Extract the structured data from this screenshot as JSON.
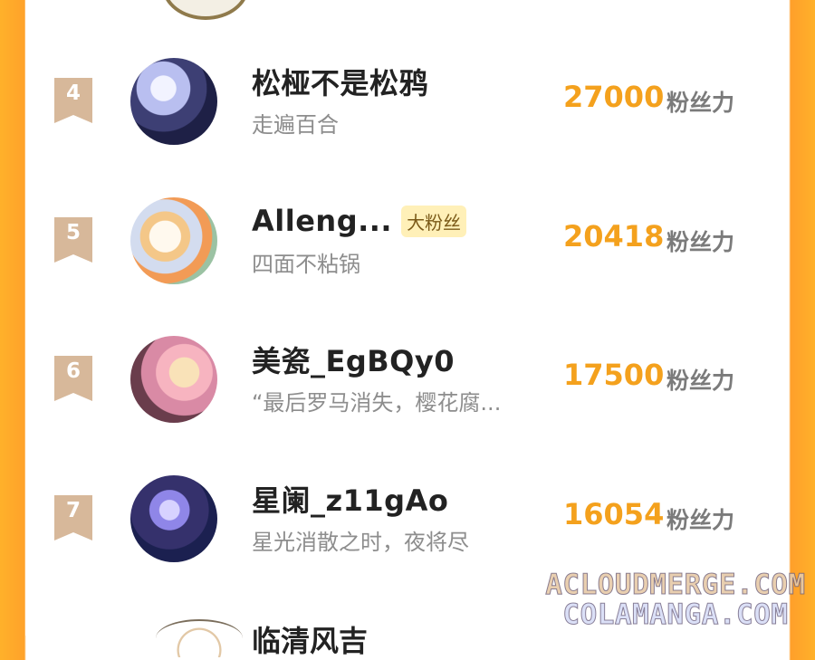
{
  "leaderboard": {
    "unit_label": "粉丝力",
    "entries": [
      {
        "rank": "4",
        "name": "松桠不是松鸦",
        "subtitle": "走遍百合",
        "score": "27000"
      },
      {
        "rank": "5",
        "name": "Alleng...",
        "badge": "大粉丝",
        "subtitle": "四面不粘锅",
        "score": "20418"
      },
      {
        "rank": "6",
        "name": "美瓷_EgBQy0",
        "subtitle": "“最后罗马消失，樱花腐...",
        "score": "17500"
      },
      {
        "rank": "7",
        "name": "星阑_z11gAo",
        "subtitle": "星光消散之时，夜将尽",
        "score": "16054"
      }
    ],
    "next_entry_name": "临清风吉"
  },
  "watermark": {
    "line1": "ACLOUDMERGE.COM",
    "line2": "COLAMANGA.COM"
  },
  "colors": {
    "accent": "#f4a11d",
    "side_orange": "#ffb12a",
    "rank_tag": "#d7b89a"
  }
}
